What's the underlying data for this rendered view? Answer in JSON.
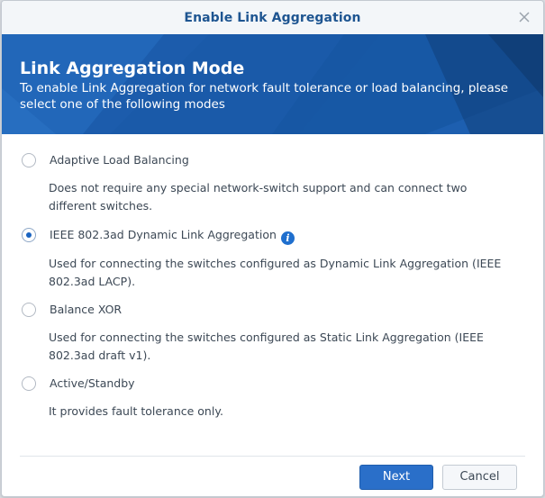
{
  "dialog": {
    "title": "Enable Link Aggregation"
  },
  "banner": {
    "title": "Link Aggregation Mode",
    "description": "To enable Link Aggregation for network fault tolerance or load balancing, please select one of the following modes"
  },
  "options": [
    {
      "label": "Adaptive Load Balancing",
      "description": "Does not require any special network-switch support and can connect two different switches.",
      "selected": false
    },
    {
      "label": "IEEE 802.3ad Dynamic Link Aggregation",
      "description": "Used for connecting the switches configured as Dynamic Link Aggregation (IEEE 802.3ad LACP).",
      "selected": true,
      "icon": "info-icon"
    },
    {
      "label": "Balance XOR",
      "description": "Used for connecting the switches configured as Static Link Aggregation (IEEE 802.3ad draft v1).",
      "selected": false
    },
    {
      "label": "Active/Standby",
      "description": "It provides fault tolerance only.",
      "selected": false
    }
  ],
  "buttons": {
    "next": "Next",
    "cancel": "Cancel"
  },
  "colors": {
    "title": "#1e5591",
    "banner": "#1d5fb0",
    "primary_button": "#2a6fc9",
    "radio_selected": "#1a64c1"
  }
}
